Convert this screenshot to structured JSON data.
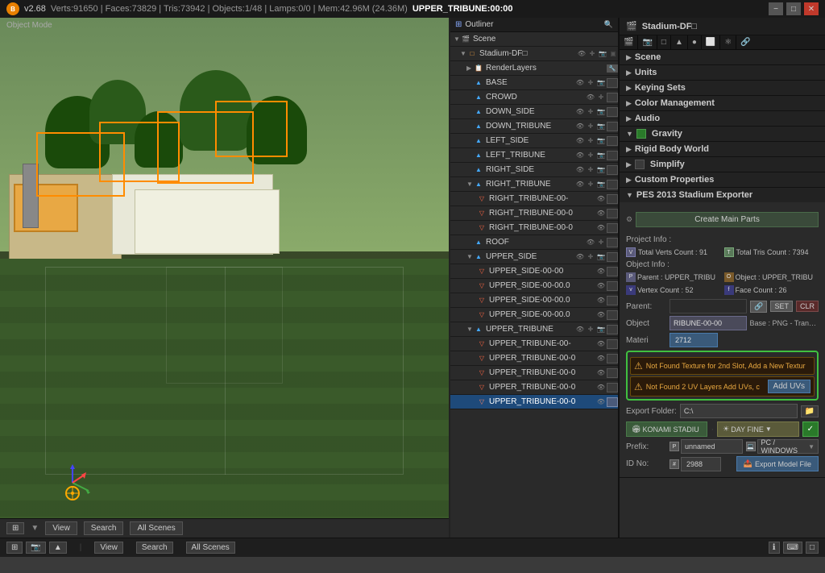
{
  "titlebar": {
    "version": "v2.68",
    "stats": "Verts:91650 | Faces:73829 | Tris:73942 | Objects:1/48 | Lamps:0/0 | Mem:42.96M (24.36M)",
    "scene": "UPPER_TRIBUNE:00:00",
    "minimize": "−",
    "maximize": "□",
    "close": "✕"
  },
  "viewport": {
    "mode": "Object Mode",
    "view": "View",
    "search": "Search",
    "all_scenes": "All Scenes"
  },
  "outliner": {
    "title": "Outliner",
    "items": [
      {
        "name": "Scene",
        "type": "scene",
        "indent": 0,
        "expand": true
      },
      {
        "name": "Stadium-DF□",
        "type": "group",
        "indent": 1,
        "expand": true
      },
      {
        "name": "RenderLayers",
        "type": "render",
        "indent": 2,
        "expand": false
      },
      {
        "name": "BASE",
        "type": "mesh",
        "indent": 2,
        "expand": false
      },
      {
        "name": "CROWD",
        "type": "mesh",
        "indent": 2,
        "expand": false
      },
      {
        "name": "DOWN_SIDE",
        "type": "mesh",
        "indent": 2,
        "expand": false
      },
      {
        "name": "DOWN_TRIBUNE",
        "type": "mesh",
        "indent": 2,
        "expand": false
      },
      {
        "name": "LEFT_SIDE",
        "type": "mesh",
        "indent": 2,
        "expand": false
      },
      {
        "name": "LEFT_TRIBUNE",
        "type": "mesh",
        "indent": 2,
        "expand": false
      },
      {
        "name": "RIGHT_SIDE",
        "type": "mesh",
        "indent": 2,
        "expand": false
      },
      {
        "name": "RIGHT_TRIBUNE",
        "type": "mesh",
        "indent": 2,
        "expand": false
      },
      {
        "name": "RIGHT_TRIBUNE-00-",
        "type": "mesh",
        "indent": 3,
        "expand": false
      },
      {
        "name": "RIGHT_TRIBUNE-00-0",
        "type": "mesh",
        "indent": 3,
        "expand": false
      },
      {
        "name": "RIGHT_TRIBUNE-00-0",
        "type": "mesh",
        "indent": 3,
        "expand": false
      },
      {
        "name": "ROOF",
        "type": "mesh",
        "indent": 2,
        "expand": false
      },
      {
        "name": "UPPER_SIDE",
        "type": "mesh",
        "indent": 2,
        "expand": false
      },
      {
        "name": "UPPER_SIDE-00-00",
        "type": "mesh",
        "indent": 3,
        "expand": false
      },
      {
        "name": "UPPER_SIDE-00-00.0",
        "type": "mesh",
        "indent": 3,
        "expand": false
      },
      {
        "name": "UPPER_SIDE-00-00.0",
        "type": "mesh",
        "indent": 3,
        "expand": false
      },
      {
        "name": "UPPER_SIDE-00-00.0",
        "type": "mesh",
        "indent": 3,
        "expand": false
      },
      {
        "name": "UPPER_TRIBUNE",
        "type": "mesh",
        "indent": 2,
        "expand": true
      },
      {
        "name": "UPPER_TRIBUNE-00-",
        "type": "mesh",
        "indent": 3,
        "expand": false
      },
      {
        "name": "UPPER_TRIBUNE-00-0",
        "type": "mesh",
        "indent": 3,
        "expand": false
      },
      {
        "name": "UPPER_TRIBUNE-00-0",
        "type": "mesh",
        "indent": 3,
        "expand": false
      },
      {
        "name": "UPPER_TRIBUNE-00-0",
        "type": "mesh",
        "indent": 3,
        "expand": false
      },
      {
        "name": "UPPER_TRIBUNE-00-0",
        "type": "mesh",
        "indent": 3,
        "selected": true,
        "expand": false
      }
    ]
  },
  "properties": {
    "header_title": "Stadium-DF□",
    "sections": {
      "scene": "Scene",
      "units": "Units",
      "keying_sets": "Keying Sets",
      "color_management": "Color Management",
      "audio": "Audio",
      "gravity": "Gravity",
      "rigid_body_world": "Rigid Body World",
      "simplify": "Simplify",
      "custom_properties": "Custom Properties"
    },
    "pes_section": {
      "title": "PES 2013 Stadium Exporter",
      "create_btn": "Create Main Parts",
      "project_info": "Project Info :",
      "total_verts": "Total Verts Count : 91",
      "total_tris": "Total Tris Count : 7394",
      "object_info": "Object Info :",
      "parent_label": "Parent : UPPER_TRIBU",
      "object_label": "Object : UPPER_TRIBU",
      "vertex_count": "Vertex Count : 52",
      "face_count": "Face Count : 26",
      "parent_field": "Parent:",
      "parent_value": "",
      "set_btn": "SET",
      "clr_btn": "CLR",
      "object_field": "Object",
      "object_value": "RIBUNE-00-00",
      "base_label": "Base : PNG - Transpare",
      "material_field": "Materi",
      "material_value": "2712",
      "warning1": "Not Found Texture for 2nd Slot, Add a New Textur",
      "warning2": "Not Found 2 UV Layers Add UVs, c",
      "add_uvs_btn": "Add UVs",
      "export_folder": "Export Folder:",
      "folder_value": "C:\\",
      "konami_btn": "KONAMI STADIU",
      "day_fine_btn": "DAY FINE",
      "prefix_label": "Prefix:",
      "prefix_value": "unnamed",
      "platform_value": "PC / WINDOWS",
      "id_label": "ID No:",
      "id_value": "2988",
      "export_model_btn": "Export Model File"
    }
  },
  "statusbar": {
    "view": "View",
    "search": "Search",
    "all_scenes": "All Scenes"
  },
  "icons": {
    "expand": "▶",
    "collapse": "▼",
    "eye": "👁",
    "camera": "📷",
    "scene": "🎬",
    "warning": "⚠",
    "checkbox_on": "✓",
    "arrow_down": "▼",
    "arrow_right": "▶",
    "folder": "📁",
    "link": "🔗"
  }
}
